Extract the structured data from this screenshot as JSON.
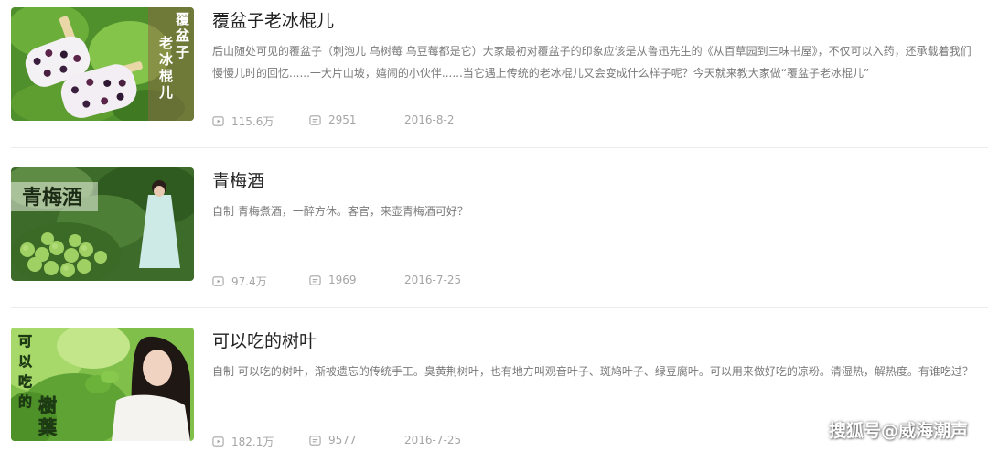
{
  "videos": [
    {
      "title": "覆盆子老冰棍儿",
      "description": "后山随处可见的覆盆子（刺泡儿 乌树莓 乌豆莓都是它）大家最初对覆盆子的印象应该是从鲁迅先生的《从百草园到三味书屋》，不仅可以入药，还承载着我们慢慢儿时的回忆......一大片山坡，嬉闹的小伙伴......当它遇上传统的老冰棍儿又会变成什么样子呢？今天就来教大家做“覆盆子老冰棍儿”",
      "thumbnail_text": "覆盆子老冰棍儿",
      "plays": "115.6万",
      "comments": "2951",
      "date": "2016-8-2"
    },
    {
      "title": "青梅酒",
      "description": "自制 青梅煮酒，一醉方休。客官，来壶青梅酒可好？",
      "thumbnail_text": "青梅酒",
      "plays": "97.4万",
      "comments": "1969",
      "date": "2016-7-25"
    },
    {
      "title": "可以吃的树叶",
      "description": "自制 可以吃的树叶，渐被遗忘的传统手工。臭黄荆树叶，也有地方叫观音叶子、斑鸠叶子、绿豆腐叶。可以用来做好吃的凉粉。清湿热，解热度。有谁吃过？",
      "thumbnail_text": "可以吃的树叶",
      "plays": "182.1万",
      "comments": "9577",
      "date": "2016-7-25"
    }
  ],
  "watermark": "搜狐号@威海潮声",
  "icons": {
    "plays": "play-icon",
    "comments": "comment-icon"
  },
  "colors": {
    "title": "#222222",
    "description": "#7a7a7a",
    "meta": "#a5a5a5"
  }
}
